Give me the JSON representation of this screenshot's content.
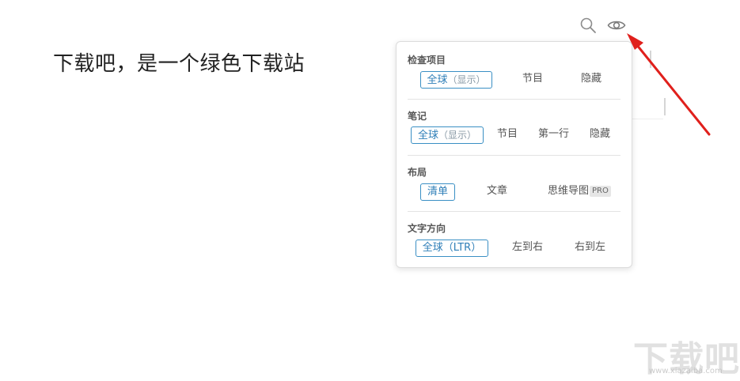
{
  "document": {
    "title": "下载吧，是一个绿色下载站"
  },
  "toolbar": {
    "search_icon": "search-icon",
    "view_icon": "eye-icon"
  },
  "view_panel": {
    "sections": [
      {
        "title": "检查项目",
        "options": [
          {
            "label": "全球",
            "sub": "（显示）",
            "selected": true
          },
          {
            "label": "节目"
          },
          {
            "label": "隐藏"
          }
        ]
      },
      {
        "title": "笔记",
        "options": [
          {
            "label": "全球",
            "sub": "（显示）",
            "selected": true
          },
          {
            "label": "节目"
          },
          {
            "label": "第一行"
          },
          {
            "label": "隐藏"
          }
        ]
      },
      {
        "title": "布局",
        "options": [
          {
            "label": "清单",
            "selected": true
          },
          {
            "label": "文章"
          },
          {
            "label": "思维导图",
            "badge": "PRO"
          }
        ]
      },
      {
        "title": "文字方向",
        "options": [
          {
            "label": "全球（LTR）",
            "selected": true
          },
          {
            "label": "左到右"
          },
          {
            "label": "右到左"
          }
        ]
      }
    ]
  },
  "annotation": {
    "arrow_color": "#e0201c"
  },
  "watermark": {
    "text": "下载吧",
    "url": "www.xiazaiba.com"
  },
  "colors": {
    "selected_border": "#3a8fc4",
    "selected_text": "#2f7fb8"
  }
}
